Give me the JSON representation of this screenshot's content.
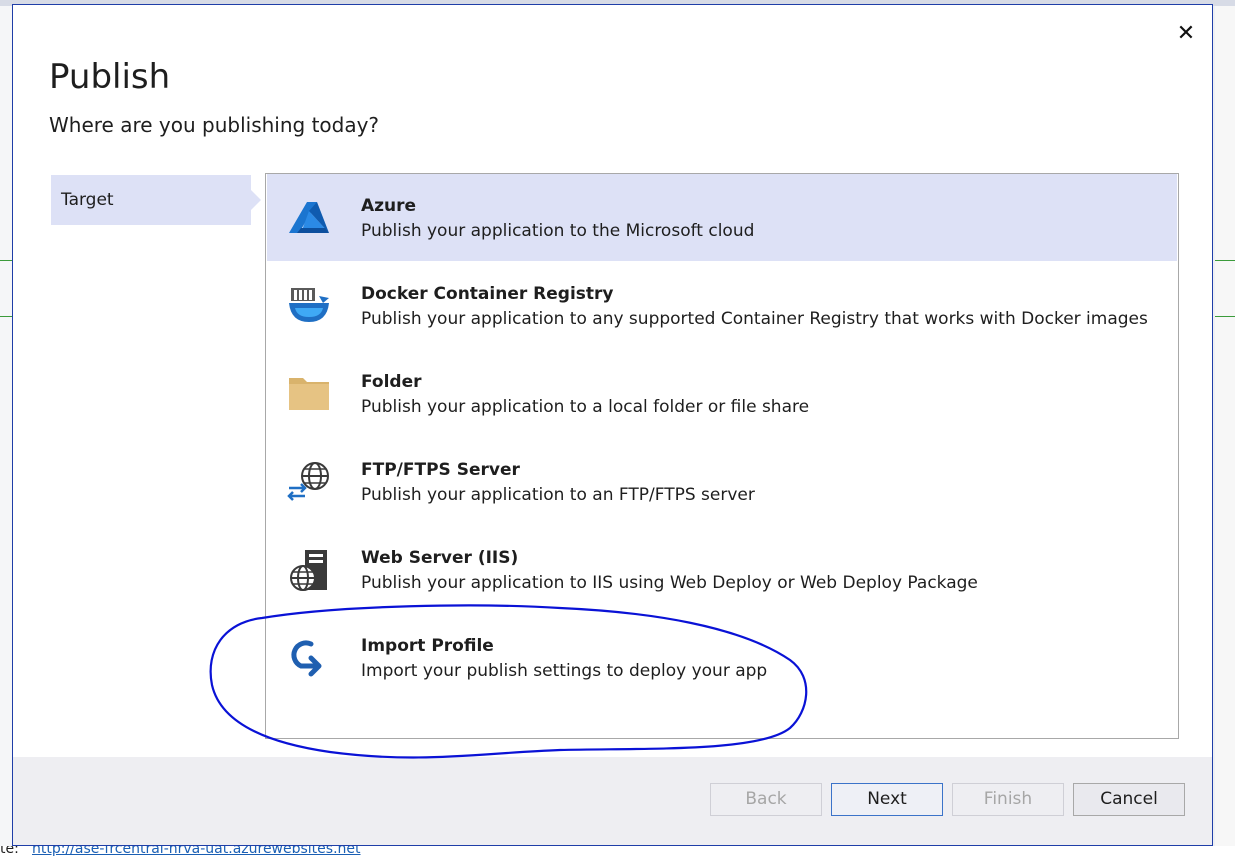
{
  "dialog": {
    "title": "Publish",
    "subtitle": "Where are you publishing today?",
    "close_glyph": "✕"
  },
  "steps": [
    {
      "label": "Target",
      "active": true
    }
  ],
  "targets": [
    {
      "name": "Azure",
      "description": "Publish your application to the Microsoft cloud",
      "icon": "azure-icon",
      "selected": true
    },
    {
      "name": "Docker Container Registry",
      "description": "Publish your application to any supported Container Registry that works with Docker images",
      "icon": "docker-icon",
      "selected": false
    },
    {
      "name": "Folder",
      "description": "Publish your application to a local folder or file share",
      "icon": "folder-icon",
      "selected": false
    },
    {
      "name": "FTP/FTPS Server",
      "description": "Publish your application to an FTP/FTPS server",
      "icon": "ftp-globe-icon",
      "selected": false
    },
    {
      "name": "Web Server (IIS)",
      "description": "Publish your application to IIS using Web Deploy or Web Deploy Package",
      "icon": "iis-server-icon",
      "selected": false
    },
    {
      "name": "Import Profile",
      "description": "Import your publish settings to deploy your app",
      "icon": "import-profile-icon",
      "selected": false
    }
  ],
  "buttons": {
    "back": "Back",
    "next": "Next",
    "finish": "Finish",
    "cancel": "Cancel"
  },
  "background": {
    "bottom_label": "te:",
    "bottom_url": "http://ase-frcentral-hrva-uat.azurewebsites.net"
  },
  "colors": {
    "selected_bg": "#dde1f6",
    "annotation": "#0a12d6",
    "accent": "#1f3ea8"
  }
}
